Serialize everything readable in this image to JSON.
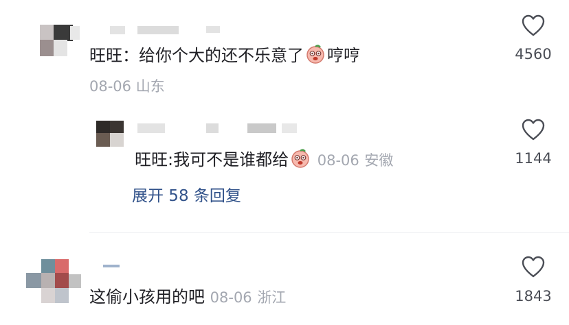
{
  "comments": [
    {
      "text": "旺旺：给你个大的还不乐意了",
      "text_tail": "哼哼",
      "date": "08-06",
      "location": "山东",
      "likes": "4560"
    },
    {
      "text": "旺旺:我可不是谁都给",
      "date": "08-06",
      "location": "安徽",
      "likes": "1144",
      "expand_label": "展开 58 条回复"
    },
    {
      "text": "这偷小孩用的吧",
      "date": "08-06",
      "location": "浙江",
      "likes": "1843"
    }
  ],
  "icons": {
    "like": "heart-outline-icon",
    "emoji": "peach-face-emoji-icon"
  },
  "colors": {
    "text": "#1f1f24",
    "meta": "#a3a7b0",
    "link": "#31528a",
    "divider": "#eeeff2"
  }
}
